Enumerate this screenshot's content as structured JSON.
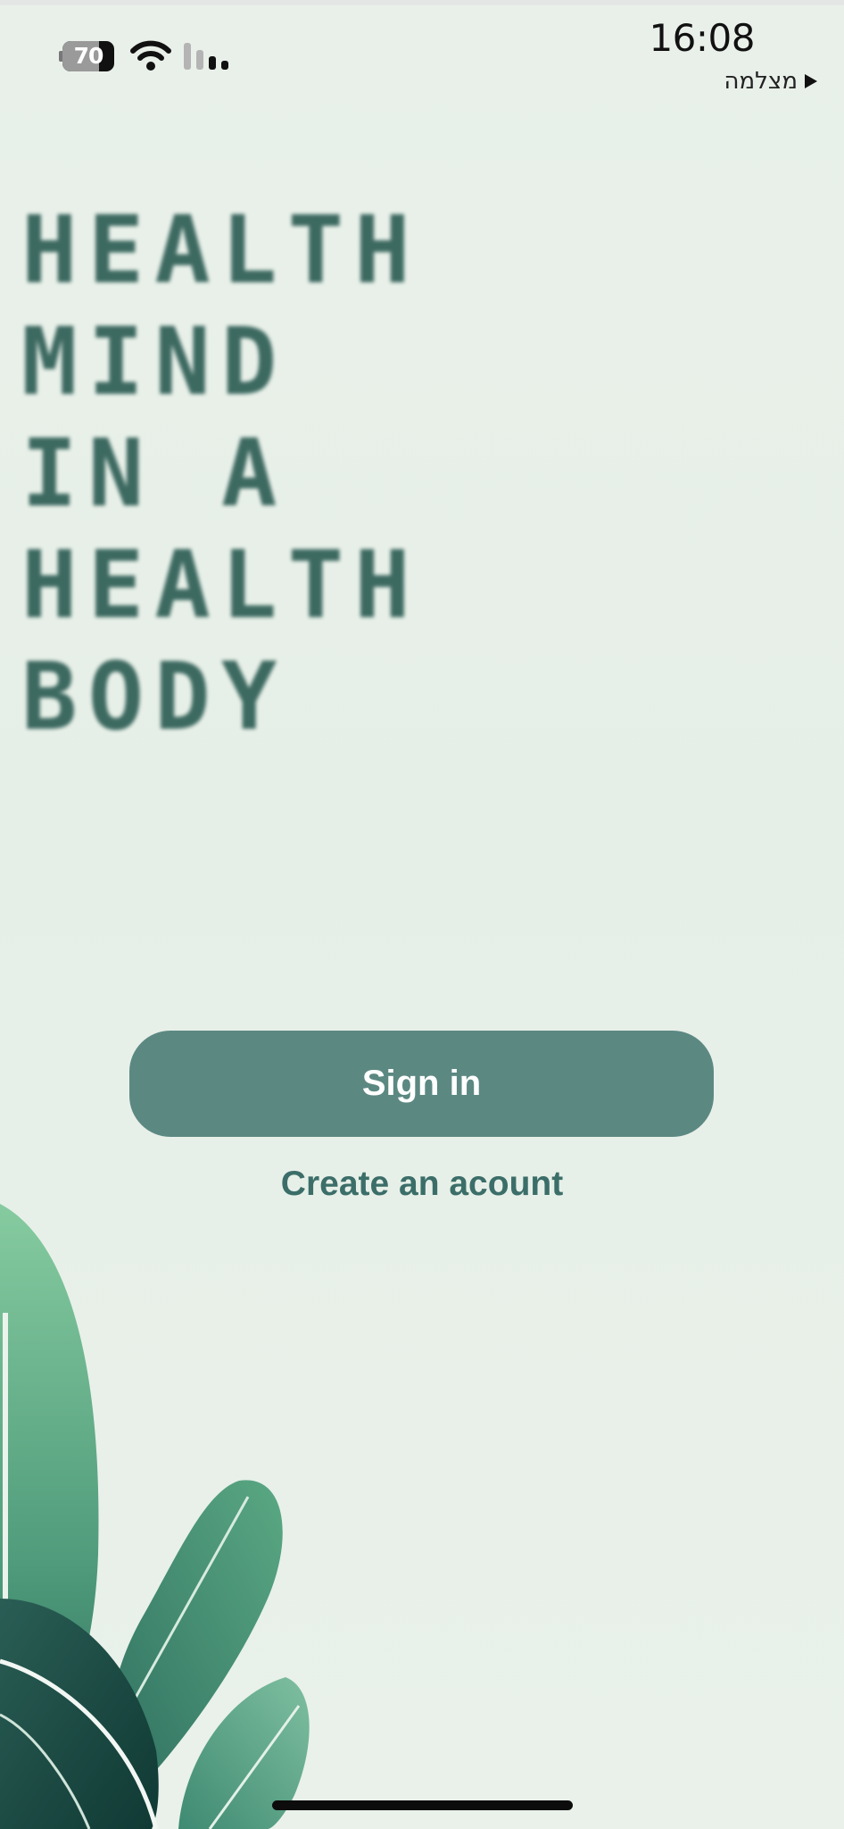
{
  "status_bar": {
    "battery_level": "70",
    "battery_percent": 70,
    "time": "16:08",
    "back_app_label": "מצלמה",
    "icons": {
      "battery": "battery-icon",
      "wifi": "wifi-icon",
      "signal": "cellular-signal-icon",
      "back": "play-triangle-icon"
    }
  },
  "hero": {
    "lines": [
      "HEALTH",
      "MIND",
      "IN A",
      "HEALTH",
      "BODY"
    ]
  },
  "actions": {
    "sign_in_label": "Sign in",
    "create_account_label": "Create an acount"
  },
  "colors": {
    "background": "#e8f0e9",
    "hero_text": "#2e5e55",
    "primary_button": "#5c8882",
    "primary_button_text": "#ffffff",
    "link_text": "#3c6e69",
    "leaf_light": "#7cc497",
    "leaf_mid": "#4e9a7a",
    "leaf_dark": "#1f4e48"
  }
}
